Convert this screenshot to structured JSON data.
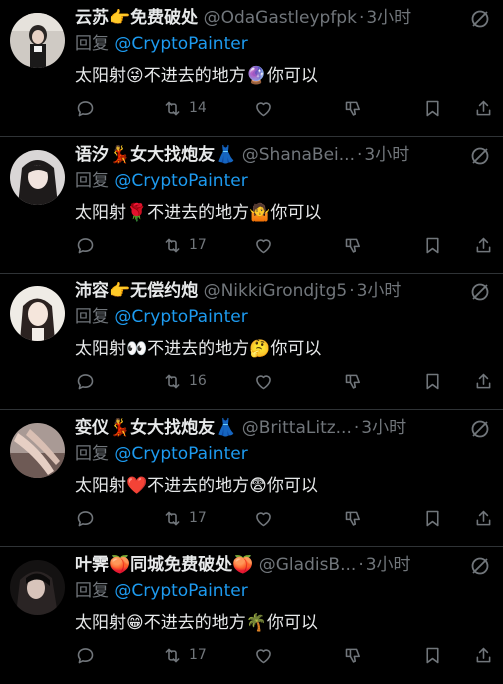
{
  "reply_prefix": "回复",
  "replies": [
    {
      "name": "云苏👉免费破处",
      "handle": "@OdaGastleypfpk",
      "time": "3小时",
      "mention": "@CryptoPainter",
      "text": "太阳射😜不进去的地方🔮你可以",
      "retweets": "14",
      "avatar_theme": "light-room"
    },
    {
      "name": "语汐💃女大找炮友👗",
      "handle": "@ShanaBei...",
      "time": "3小时",
      "mention": "@CryptoPainter",
      "text": "太阳射🌹不进去的地方🤷你可以",
      "retweets": "17",
      "avatar_theme": "dark-hair"
    },
    {
      "name": "沛容👉无偿约炮",
      "handle": "@NikkiGrondjtg5",
      "time": "3小时",
      "mention": "@CryptoPainter",
      "text": "太阳射👀不进去的地方🤔你可以",
      "retweets": "16",
      "avatar_theme": "bright-face"
    },
    {
      "name": "娈仪💃女大找炮友👗",
      "handle": "@BrittaLitz...",
      "time": "3小时",
      "mention": "@CryptoPainter",
      "text": "太阳射❤️不进去的地方😨你可以",
      "retweets": "17",
      "avatar_theme": "legs"
    },
    {
      "name": "叶霁🍑同城免费破处🍑",
      "handle": "@GladisB...",
      "time": "3小时",
      "mention": "@CryptoPainter",
      "text": "太阳射😁不进去的地方🌴你可以",
      "retweets": "17",
      "avatar_theme": "dark-silhouette"
    }
  ]
}
